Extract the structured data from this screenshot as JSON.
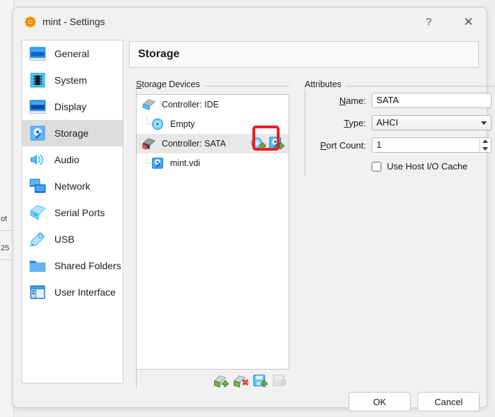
{
  "window": {
    "title": "mint - Settings",
    "icon": "vbox-gear-icon",
    "help_label": "?",
    "close_label": "✕"
  },
  "background": {
    "fragment_1": "ot",
    "fragment_2": "25"
  },
  "sidebar": {
    "items": [
      {
        "label": "General",
        "icon": "monitor-icon",
        "selected": false
      },
      {
        "label": "System",
        "icon": "chip-icon",
        "selected": false
      },
      {
        "label": "Display",
        "icon": "display-icon",
        "selected": false
      },
      {
        "label": "Storage",
        "icon": "harddisk-icon",
        "selected": true
      },
      {
        "label": "Audio",
        "icon": "speaker-icon",
        "selected": false
      },
      {
        "label": "Network",
        "icon": "network-icon",
        "selected": false
      },
      {
        "label": "Serial Ports",
        "icon": "serial-port-icon",
        "selected": false
      },
      {
        "label": "USB",
        "icon": "usb-icon",
        "selected": false
      },
      {
        "label": "Shared Folders",
        "icon": "folder-icon",
        "selected": false
      },
      {
        "label": "User Interface",
        "icon": "user-interface-icon",
        "selected": false
      }
    ]
  },
  "main": {
    "header_title": "Storage",
    "devices_group": {
      "label_prefix": "S",
      "label_rest": "torage Devices",
      "tree": [
        {
          "label": "Controller: IDE",
          "icon": "ide-controller-icon",
          "level": 0,
          "selected": false,
          "inline_icons": []
        },
        {
          "label": "Empty",
          "icon": "cd-drive-icon",
          "level": 1,
          "selected": false,
          "inline_icons": []
        },
        {
          "label": "Controller: SATA",
          "icon": "sata-controller-icon",
          "level": 0,
          "selected": true,
          "inline_icons": [
            "add-optical-drive-icon",
            "add-hard-disk-icon"
          ]
        },
        {
          "label": "mint.vdi",
          "icon": "hard-disk-icon",
          "level": 1,
          "selected": false,
          "inline_icons": []
        }
      ],
      "toolbar": [
        {
          "name": "add-controller-button",
          "enabled": true
        },
        {
          "name": "remove-controller-button",
          "enabled": true
        },
        {
          "name": "add-attachment-button",
          "enabled": true
        },
        {
          "name": "remove-attachment-button",
          "enabled": false
        }
      ]
    },
    "attributes_group": {
      "label": "Attributes",
      "name_label_prefix": "N",
      "name_label_rest": "ame:",
      "name_value": "SATA",
      "type_label_prefix": "T",
      "type_label_rest": "ype:",
      "type_value": "AHCI",
      "port_label_prefix": "P",
      "port_label_rest": "ort Count:",
      "port_value": "1",
      "host_cache_label": "Use Host I/O Cache",
      "host_cache_checked": false
    }
  },
  "footer": {
    "ok_label": "OK",
    "cancel_label": "Cancel"
  },
  "annotation": {
    "target": "add-hard-disk-icon",
    "color": "#ee1c25"
  }
}
